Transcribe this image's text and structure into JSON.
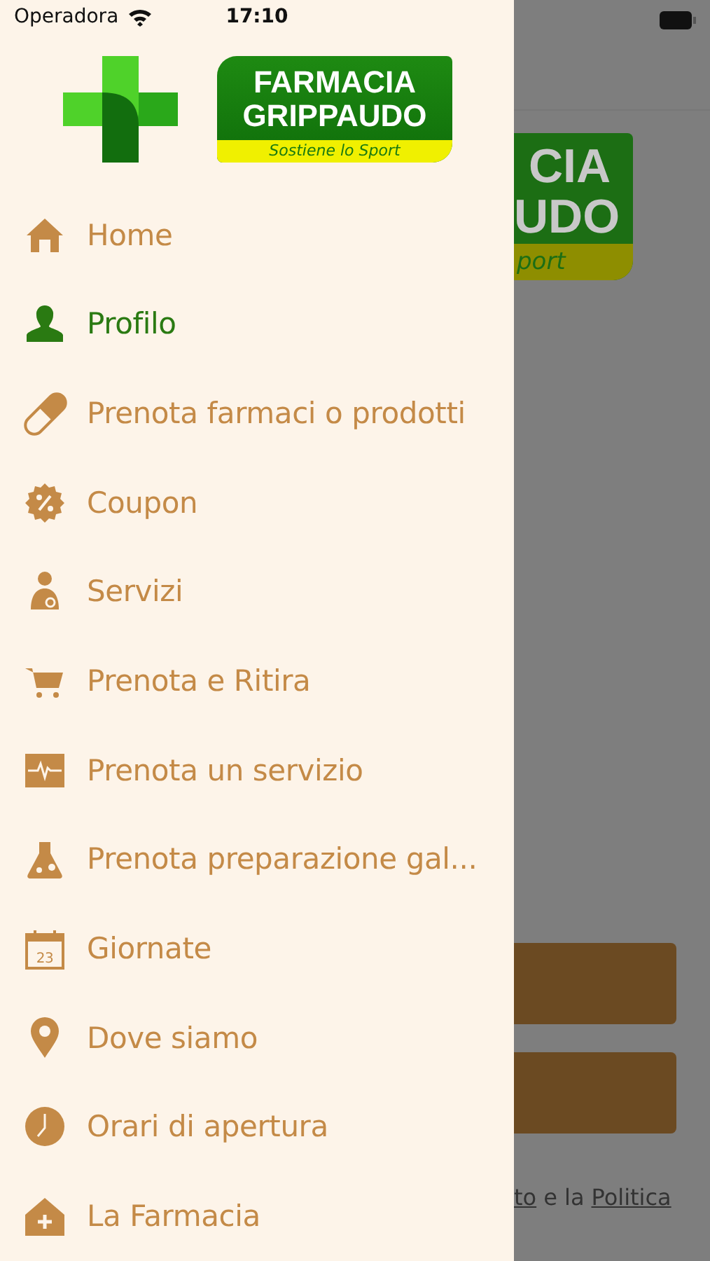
{
  "status_bar": {
    "carrier": "Operadora",
    "time": "17:10"
  },
  "drawer": {
    "logo": {
      "title_lines": [
        "FARMACIA",
        "GRIPPAUDO"
      ],
      "tagline": "Sostiene lo Sport"
    },
    "items": [
      {
        "label": "Home",
        "kind": "home",
        "selected": false
      },
      {
        "label": "Profilo",
        "kind": "person",
        "selected": true
      },
      {
        "label": "Prenota farmaci o prodotti",
        "kind": "pill",
        "selected": false
      },
      {
        "label": "Coupon",
        "kind": "coupon",
        "selected": false
      },
      {
        "label": "Servizi",
        "kind": "doctor",
        "selected": false
      },
      {
        "label": "Prenota e Ritira",
        "kind": "cart",
        "selected": false
      },
      {
        "label": "Prenota un servizio",
        "kind": "pulse",
        "selected": false
      },
      {
        "label": "Prenota preparazione gal...",
        "kind": "flask",
        "selected": false
      },
      {
        "label": "Giornate",
        "kind": "calendar",
        "icon_text": "23",
        "selected": false
      },
      {
        "label": "Dove siamo",
        "kind": "pin",
        "selected": false
      },
      {
        "label": "Orari di apertura",
        "kind": "clock",
        "selected": false
      },
      {
        "label": "La Farmacia",
        "kind": "pharmacy",
        "selected": false
      }
    ]
  },
  "background_page": {
    "logo_lines": [
      "CIA",
      "UDO"
    ],
    "tagline": "port",
    "buttons": [
      {
        "kind": "button"
      },
      {
        "kind": "button"
      }
    ],
    "footer": [
      {
        "text": "to",
        "link": true
      },
      {
        "text": "e la",
        "link": false
      },
      {
        "text": "Politica",
        "link": true
      }
    ]
  }
}
